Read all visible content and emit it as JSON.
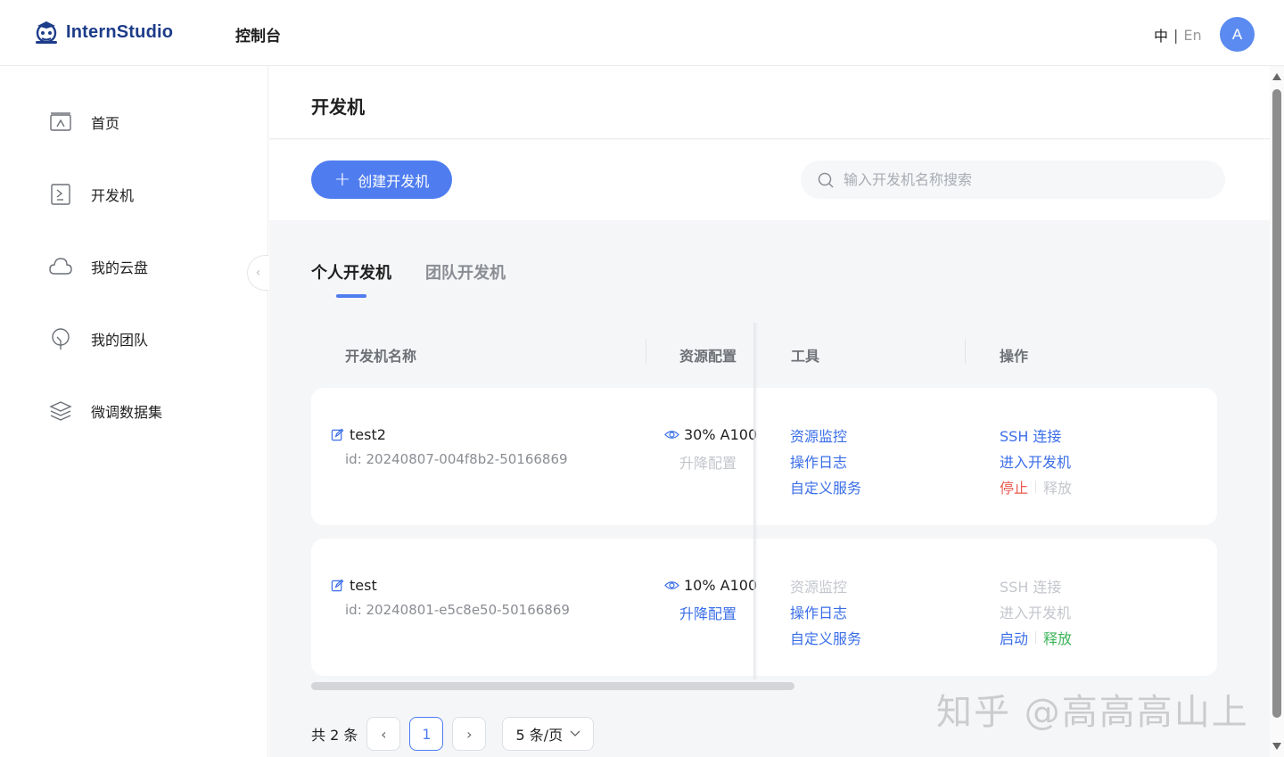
{
  "header": {
    "logo_text": "InternStudio",
    "console_label": "控制台",
    "lang_zh": "中",
    "lang_sep": "|",
    "lang_en": "En",
    "avatar_letter": "A"
  },
  "sidebar": {
    "items": [
      {
        "label": "首页",
        "icon": "home-icon"
      },
      {
        "label": "开发机",
        "icon": "terminal-icon"
      },
      {
        "label": "我的云盘",
        "icon": "cloud-icon"
      },
      {
        "label": "我的团队",
        "icon": "team-icon"
      },
      {
        "label": "微调数据集",
        "icon": "layers-icon"
      }
    ],
    "collapse_icon": "chevron-left-icon"
  },
  "main": {
    "title": "开发机",
    "create_button": "创建开发机",
    "search_placeholder": "输入开发机名称搜索",
    "tabs": [
      {
        "label": "个人开发机",
        "active": true
      },
      {
        "label": "团队开发机",
        "active": false
      }
    ],
    "columns": {
      "name": "开发机名称",
      "resource": "资源配置",
      "tools": "工具",
      "ops": "操作"
    },
    "rows": [
      {
        "name": "test2",
        "id": "id: 20240807-004f8b2-50166869",
        "resource": "30% A100",
        "upgrade": "升降配置",
        "upgrade_enabled": false,
        "tools": [
          {
            "label": "资源监控",
            "enabled": true
          },
          {
            "label": "操作日志",
            "enabled": true
          },
          {
            "label": "自定义服务",
            "enabled": true
          }
        ],
        "ops": {
          "ssh": "SSH 连接",
          "ssh_enabled": true,
          "enter": "进入开发机",
          "enter_enabled": true,
          "toggle": "停止",
          "release": "释放",
          "release_enabled": false
        }
      },
      {
        "name": "test",
        "id": "id: 20240801-e5c8e50-50166869",
        "resource": "10% A100",
        "upgrade": "升降配置",
        "upgrade_enabled": true,
        "tools": [
          {
            "label": "资源监控",
            "enabled": false
          },
          {
            "label": "操作日志",
            "enabled": true
          },
          {
            "label": "自定义服务",
            "enabled": true
          }
        ],
        "ops": {
          "ssh": "SSH 连接",
          "ssh_enabled": false,
          "enter": "进入开发机",
          "enter_enabled": false,
          "toggle": "启动",
          "release": "释放",
          "release_enabled": true
        }
      }
    ],
    "pagination": {
      "total_label": "共 2 条",
      "current_page": "1",
      "page_size": "5 条/页"
    }
  },
  "watermark": "知乎 @高高高山上",
  "colors": {
    "primary": "#4f7df0",
    "link": "#3a6ee8",
    "danger": "#e85a4f",
    "success": "#3db45a",
    "disabled": "#c3c6cc"
  }
}
